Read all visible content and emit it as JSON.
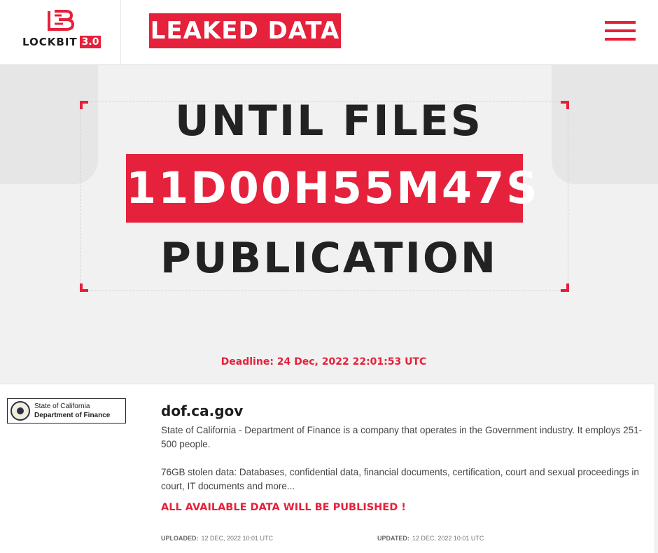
{
  "header": {
    "logo_word": "LOCKBIT",
    "logo_version": "3.0",
    "leaked_label": "LEAKED DATA"
  },
  "timer": {
    "line_1": "UNTIL FILES",
    "countdown": "11D00H55M47S",
    "line_3": "PUBLICATION",
    "deadline": "Deadline: 24 Dec, 2022 22:01:53 UTC"
  },
  "victim": {
    "logo_line_1": "State of California",
    "logo_line_2": "Department of Finance",
    "domain": "dof.ca.gov",
    "description": "State of California - Department of Finance is a company that operates in the Government industry. It employs 251-500 people.",
    "stolen_data": "76GB stolen data: Databases, confidential data, financial documents, certification, court and sexual proceedings in court, IT documents and more...",
    "warning": "ALL AVAILABLE DATA WILL BE PUBLISHED !",
    "uploaded_label": "UPLOADED:",
    "uploaded_value": "12 DEC, 2022 10:01 UTC",
    "updated_label": "UPDATED:",
    "updated_value": "12 DEC, 2022 10:01 UTC"
  },
  "icons": {
    "brand_logo": "lockbit-logo-icon",
    "menu": "hamburger-menu-icon",
    "victim_seal": "state-seal-icon"
  },
  "colors": {
    "accent": "#e5213b",
    "text_dark": "#222222",
    "background": "#f1f1f1"
  }
}
